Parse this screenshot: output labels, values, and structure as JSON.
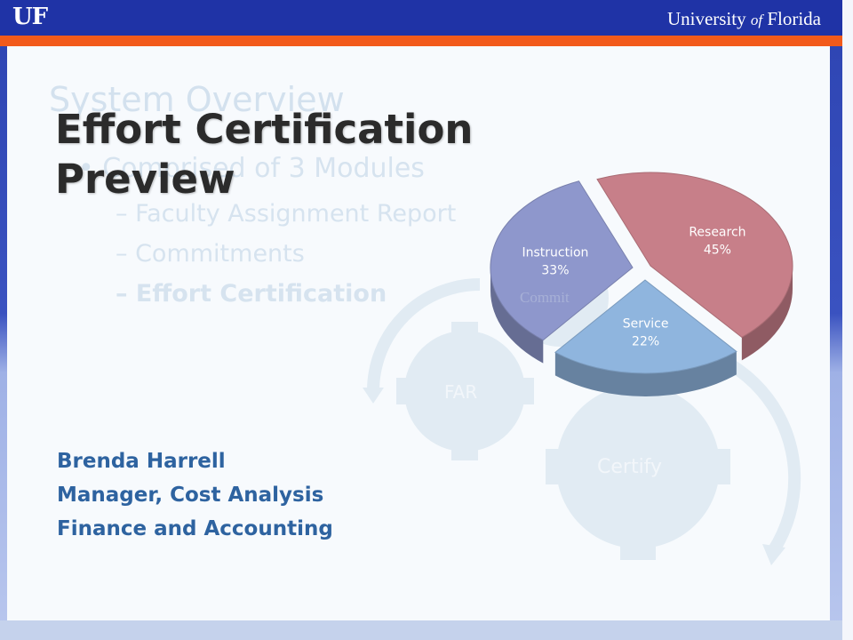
{
  "header": {
    "logo": "UF",
    "university_prefix": "University",
    "university_of": "of",
    "university_suffix": "Florida"
  },
  "background_slide": {
    "title": "System Overview",
    "bullet": "• Comprised of 3 Modules",
    "sub_items": [
      "– Faculty Assignment Report",
      "– Commitments",
      "– Effort Certification"
    ],
    "gear_labels": [
      "FAR",
      "Commit",
      "Certify"
    ]
  },
  "slide": {
    "title_line1": "Effort Certification",
    "title_line2": "Preview",
    "presenter": {
      "name": "Brenda Harrell",
      "role": "Manager, Cost Analysis",
      "department": "Finance and Accounting"
    }
  },
  "chart_data": {
    "type": "pie",
    "style": "3d-exploded",
    "title": "",
    "categories": [
      "Research",
      "Service",
      "Instruction"
    ],
    "values": [
      45,
      22,
      33
    ],
    "labels": [
      "45%",
      "22%",
      "33%"
    ],
    "colors": {
      "Research": "#c77f89",
      "Service": "#8fb5de",
      "Instruction": "#8e97cc"
    }
  },
  "colors": {
    "header_blue": "#1f33a6",
    "header_orange": "#f25a1b",
    "title_text": "#2b2b2b",
    "presenter_text": "#2e63a0"
  }
}
